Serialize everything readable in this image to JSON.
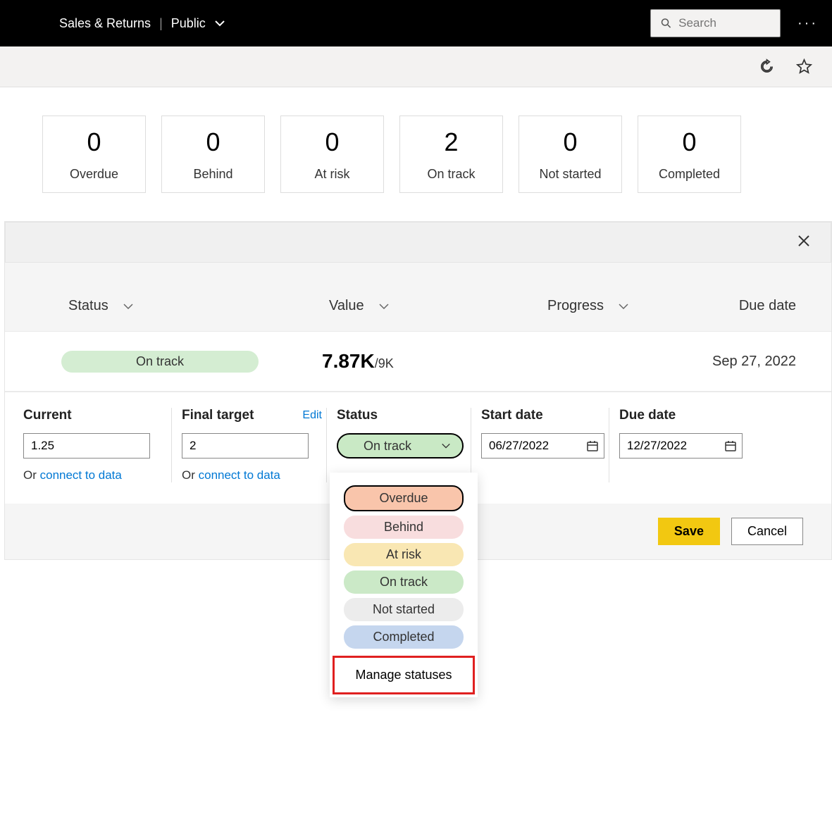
{
  "header": {
    "title": "Sales & Returns",
    "visibility": "Public",
    "search_placeholder": "Search"
  },
  "status_cards": [
    {
      "count": "0",
      "label": "Overdue"
    },
    {
      "count": "0",
      "label": "Behind"
    },
    {
      "count": "0",
      "label": "At risk"
    },
    {
      "count": "2",
      "label": "On track"
    },
    {
      "count": "0",
      "label": "Not started"
    },
    {
      "count": "0",
      "label": "Completed"
    }
  ],
  "columns": {
    "status": "Status",
    "value": "Value",
    "progress": "Progress",
    "due": "Due date"
  },
  "metric_row": {
    "status": "On track",
    "value": "7.87K",
    "value_denom": "/9K",
    "due": "Sep 27, 2022"
  },
  "form": {
    "current_label": "Current",
    "current_value": "1.25",
    "final_target_label": "Final target",
    "final_target_value": "2",
    "edit_label": "Edit",
    "or_text": "Or ",
    "connect_link": "connect to data",
    "status_label": "Status",
    "status_value": "On track",
    "start_date_label": "Start date",
    "start_date_value": "06/27/2022",
    "due_date_label": "Due date",
    "due_date_value": "12/27/2022"
  },
  "dropdown": {
    "overdue": "Overdue",
    "behind": "Behind",
    "at_risk": "At risk",
    "on_track": "On track",
    "not_started": "Not started",
    "completed": "Completed",
    "manage": "Manage statuses"
  },
  "buttons": {
    "save": "Save",
    "cancel": "Cancel"
  }
}
